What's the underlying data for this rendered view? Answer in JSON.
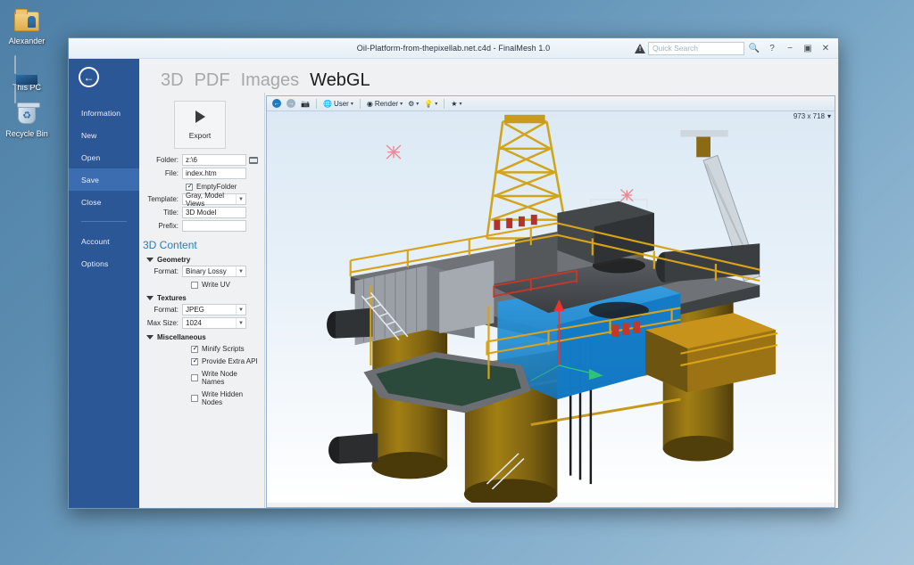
{
  "desktop": {
    "icons": [
      {
        "label": "Alexander",
        "icon": "user-folder-icon"
      },
      {
        "label": "This PC",
        "icon": "computer-icon"
      },
      {
        "label": "Recycle Bin",
        "icon": "recycle-bin-icon"
      }
    ]
  },
  "window": {
    "title": "Oil-Platform-from-thepixellab.net.c4d - FinalMesh 1.0",
    "search": {
      "placeholder": "Quick Search",
      "value": ""
    },
    "controls": {
      "warning": "warning-icon",
      "search_icon": "search-icon",
      "help": "?",
      "minimize": "−",
      "restore": "▣",
      "close": "✕"
    }
  },
  "sidebar": {
    "back_label": "←",
    "items": [
      {
        "label": "Information",
        "selected": false
      },
      {
        "label": "New",
        "selected": false
      },
      {
        "label": "Open",
        "selected": false
      },
      {
        "label": "Save",
        "selected": true
      },
      {
        "label": "Close",
        "selected": false
      },
      {
        "label": "Account",
        "selected": false
      },
      {
        "label": "Options",
        "selected": false
      }
    ]
  },
  "tabs": [
    {
      "label": "3D",
      "active": false
    },
    {
      "label": "PDF",
      "active": false
    },
    {
      "label": "Images",
      "active": false
    },
    {
      "label": "WebGL",
      "active": true
    }
  ],
  "settings": {
    "export_label": "Export",
    "folder": {
      "label": "Folder:",
      "value": "z:\\6"
    },
    "file": {
      "label": "File:",
      "value": "index.htm"
    },
    "empty_folder": {
      "label": "EmptyFolder",
      "checked": true
    },
    "template": {
      "label": "Template:",
      "value": "Gray, Model Views"
    },
    "title": {
      "label": "Title:",
      "value": "3D Model"
    },
    "prefix": {
      "label": "Prefix:",
      "value": ""
    },
    "section_title": "3D Content",
    "geometry": {
      "heading": "Geometry",
      "format": {
        "label": "Format:",
        "value": "Binary Lossy"
      },
      "write_uv": {
        "label": "Write UV",
        "checked": false
      }
    },
    "textures": {
      "heading": "Textures",
      "format": {
        "label": "Format:",
        "value": "JPEG"
      },
      "max_size": {
        "label": "Max Size:",
        "value": "1024"
      }
    },
    "miscellaneous": {
      "heading": "Miscellaneous",
      "options": [
        {
          "label": "Minify Scripts",
          "checked": true
        },
        {
          "label": "Provide Extra API",
          "checked": true
        },
        {
          "label": "Write Node Names",
          "checked": false
        },
        {
          "label": "Write Hidden Nodes",
          "checked": false
        }
      ]
    }
  },
  "viewer": {
    "toolbar": {
      "back": "back-icon",
      "forward": "forward-icon",
      "camera": "camera-icon",
      "user": "User",
      "render": "Render",
      "settings": "gear-icon",
      "light": "light-icon",
      "favorite": "star-icon",
      "caret": "▾"
    },
    "resolution": "973 x 718",
    "resolution_caret": "▾"
  },
  "colors": {
    "sidebar_blue": "#2b5797",
    "sidebar_selected": "#3c6db1",
    "accent_heading": "#2b7bb9",
    "structure_yellow": "#d8a319",
    "structure_dark_yellow": "#8a6a12",
    "module_blue": "#1f8fe0",
    "helipad_green": "#2c4a3c",
    "gizmo_red": "#e8362c",
    "gizmo_green": "#2fc27a",
    "light_marker_pink": "#e98a93"
  }
}
